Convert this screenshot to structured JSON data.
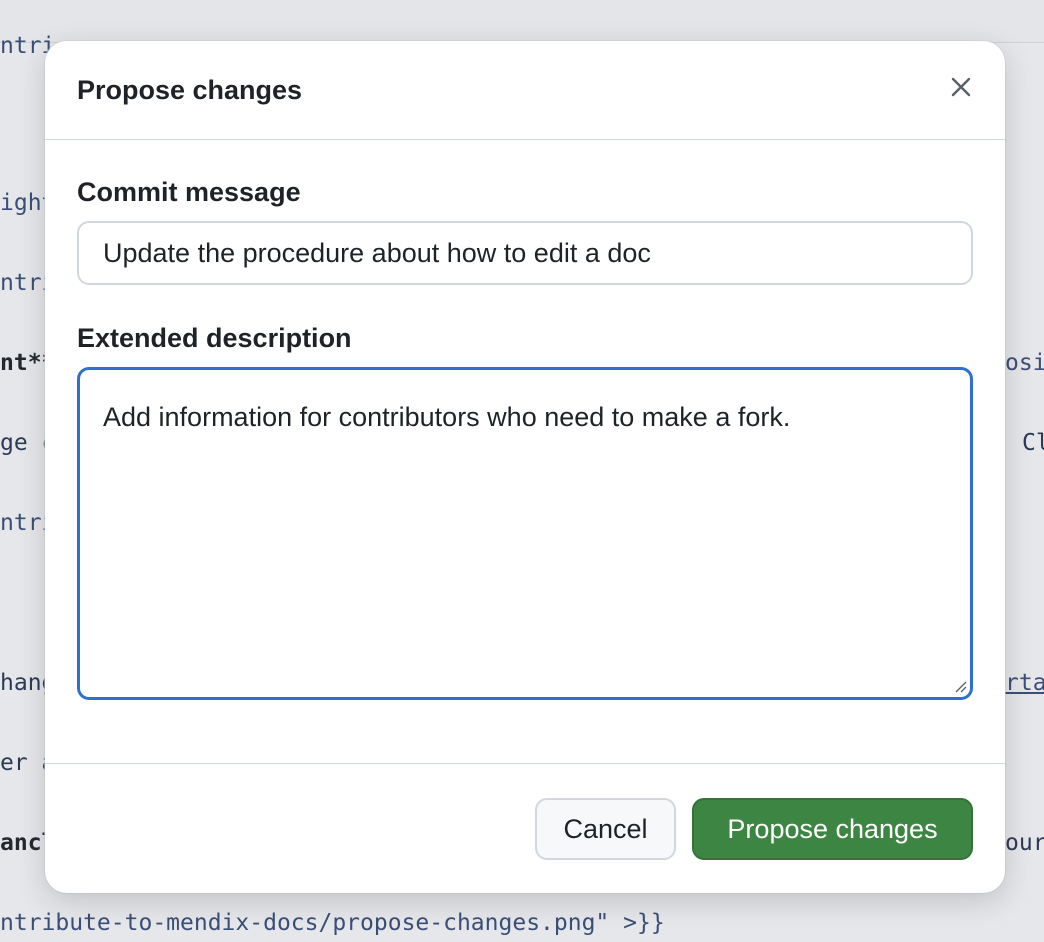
{
  "background": {
    "lines": [
      {
        "text": "ntri",
        "style": "blue"
      },
      {
        "text": "ight",
        "style": "blue"
      },
      {
        "text": "ntri",
        "style": "blue"
      },
      {
        "text": "nt**",
        "style": "bold"
      },
      {
        "text": "osi",
        "style": "blue"
      },
      {
        "text": "ge c",
        "style": "plain"
      },
      {
        "text": "Cl",
        "style": "plain"
      },
      {
        "text": "ntri",
        "style": "blue"
      },
      {
        "text": "hang",
        "style": "plain"
      },
      {
        "text": "rtal",
        "style": "link"
      },
      {
        "text": "er a",
        "style": "plain"
      },
      {
        "text": "ancl",
        "style": "bold"
      },
      {
        "text": "our",
        "style": "plain"
      },
      {
        "text": "ntribute-to-mendix-docs/propose-changes.png\" >}}",
        "style": "blue"
      }
    ]
  },
  "modal": {
    "title": "Propose changes",
    "commit_message": {
      "label": "Commit message",
      "value": "Update the procedure about how to edit a doc"
    },
    "extended_description": {
      "label": "Extended description",
      "value": "Add information for contributors who need to make a fork."
    },
    "buttons": {
      "cancel": "Cancel",
      "propose": "Propose changes"
    }
  },
  "colors": {
    "primary_button": "#3d8542",
    "focus_border": "#2f6fcf",
    "backdrop": "#e6e7ea"
  },
  "icons": {
    "close": "close-icon",
    "resize": "resize-handle-icon"
  }
}
